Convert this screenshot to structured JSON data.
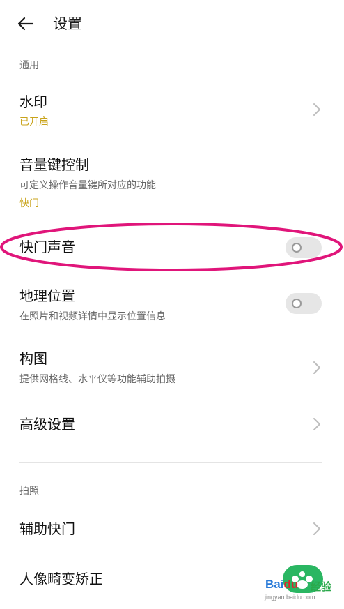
{
  "header": {
    "title": "设置",
    "back_icon": "arrow-left-icon"
  },
  "sections": {
    "general": "通用",
    "photo": "拍照"
  },
  "rows": {
    "watermark": {
      "title": "水印",
      "status": "已开启"
    },
    "volume_key": {
      "title": "音量键控制",
      "subtitle": "可定义操作音量键所对应的功能",
      "status": "快门"
    },
    "shutter_sound": {
      "title": "快门声音",
      "enabled": false
    },
    "location": {
      "title": "地理位置",
      "subtitle": "在照片和视频详情中显示位置信息",
      "enabled": false
    },
    "composition": {
      "title": "构图",
      "subtitle": "提供网格线、水平仪等功能辅助拍摄"
    },
    "advanced": {
      "title": "高级设置"
    },
    "assist_shutter": {
      "title": "辅助快门"
    },
    "portrait_correction": {
      "title": "人像畸变矫正"
    }
  },
  "watermark_brand": {
    "text": "Bai",
    "text2": "du",
    "cn": "经验",
    "sub": "jingyan.baidu.com"
  },
  "colors": {
    "accent_status": "#c9a31a",
    "highlight_ellipse": "#e0157a"
  }
}
